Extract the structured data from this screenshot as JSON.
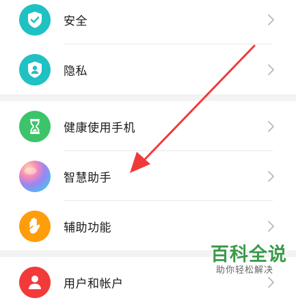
{
  "settings": {
    "items": [
      {
        "label": "安全",
        "icon": "shield-check-icon",
        "color": "#1fc1c3"
      },
      {
        "label": "隐私",
        "icon": "privacy-shield-icon",
        "color": "#1fc1c3"
      },
      {
        "label": "健康使用手机",
        "icon": "hourglass-icon",
        "color": "#3cc46a"
      },
      {
        "label": "智慧助手",
        "icon": "smart-assistant-icon",
        "color": "#8b7ef0"
      },
      {
        "label": "辅助功能",
        "icon": "hand-icon",
        "color": "#ff9d0a"
      },
      {
        "label": "用户和帐户",
        "icon": "user-icon",
        "color": "#f23a3a"
      }
    ]
  },
  "watermark": {
    "title": "百科全说",
    "subtitle": "助你轻松解决"
  }
}
